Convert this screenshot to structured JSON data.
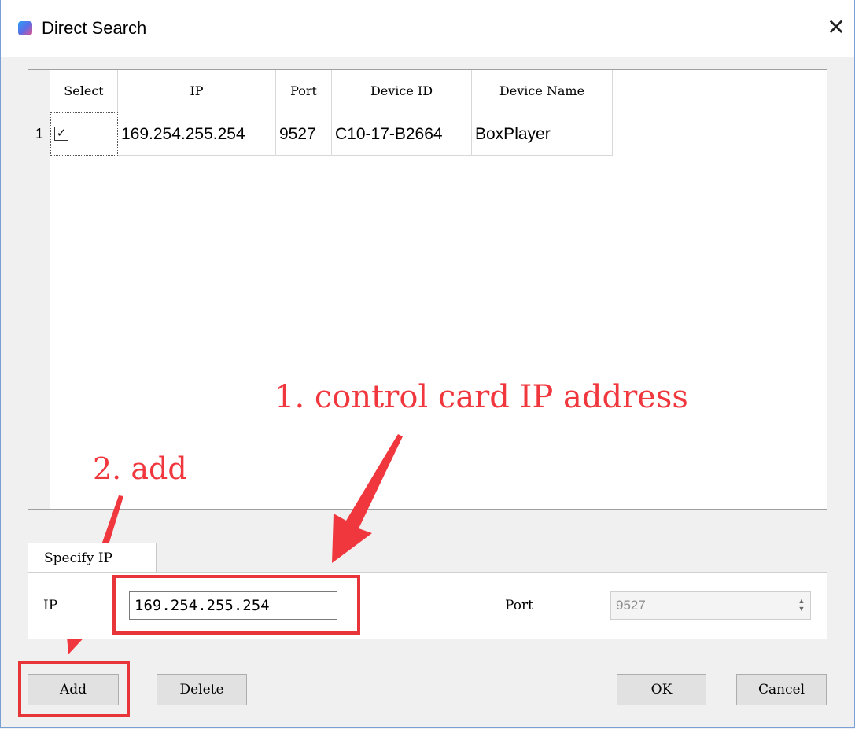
{
  "window": {
    "title": "Direct Search",
    "close": "✕"
  },
  "grid": {
    "columns": [
      "Select",
      "IP",
      "Port",
      "Device ID",
      "Device Name"
    ],
    "rows": [
      {
        "num": "1",
        "checked": "✓",
        "ip": "169.254.255.254",
        "port": "9527",
        "device_id": "C10-17-B2664",
        "device_name": "BoxPlayer"
      }
    ]
  },
  "annotations": {
    "step1": "1. control card IP address",
    "step2": "2. add"
  },
  "specify": {
    "tab_label": "Specify IP",
    "ip_label": "IP",
    "ip_value": "169.254.255.254",
    "port_label": "Port",
    "port_value": "9527"
  },
  "buttons": {
    "add": "Add",
    "delete": "Delete",
    "ok": "OK",
    "cancel": "Cancel"
  },
  "colors": {
    "annotation": "#f0373d",
    "titlebar": "#ffffff"
  }
}
